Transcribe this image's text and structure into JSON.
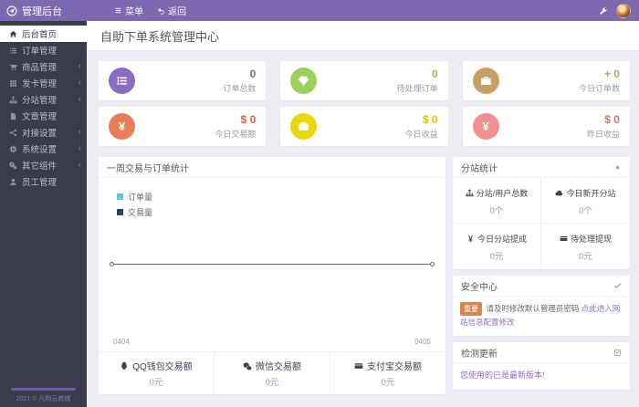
{
  "app": {
    "brand": "管理后台",
    "menu_label": "菜单",
    "back_label": "返回"
  },
  "sidebar": {
    "items": [
      {
        "id": "dashboard",
        "label": "后台首页",
        "icon": "home",
        "active": true,
        "has_children": false
      },
      {
        "id": "orders",
        "label": "订单管理",
        "icon": "list",
        "active": false,
        "has_children": false
      },
      {
        "id": "products",
        "label": "商品管理",
        "icon": "cart",
        "active": false,
        "has_children": true
      },
      {
        "id": "cards",
        "label": "发卡管理",
        "icon": "grid",
        "active": false,
        "has_children": true
      },
      {
        "id": "substations",
        "label": "分站管理",
        "icon": "sitemap",
        "active": false,
        "has_children": true
      },
      {
        "id": "articles",
        "label": "文章管理",
        "icon": "file",
        "active": false,
        "has_children": false
      },
      {
        "id": "integration",
        "label": "对接设置",
        "icon": "share",
        "active": false,
        "has_children": true
      },
      {
        "id": "system",
        "label": "系统设置",
        "icon": "gear",
        "active": false,
        "has_children": true
      },
      {
        "id": "components",
        "label": "其它组件",
        "icon": "cogs",
        "active": false,
        "has_children": true
      },
      {
        "id": "staff",
        "label": "员工管理",
        "icon": "users",
        "active": false,
        "has_children": false
      }
    ],
    "footer": "2021 © 凡购云商城"
  },
  "page": {
    "title": "自助下单系统管理中心"
  },
  "stats": [
    {
      "id": "order-total",
      "label": "订单总数",
      "value": "0",
      "icon": "ol",
      "color": "#8b6cc3",
      "value_color": "#7a5fc0"
    },
    {
      "id": "order-pending",
      "label": "待处理订单",
      "value": "0",
      "icon": "gem",
      "color": "#9bd05e",
      "value_color": "#8cc44f"
    },
    {
      "id": "order-today",
      "label": "今日订单数",
      "value": "+ 0",
      "icon": "briefcase",
      "color": "#c7a163",
      "value_color": "#c3a05f"
    },
    {
      "id": "trade-today",
      "label": "今日交易额",
      "value": "$ 0",
      "icon": "yen",
      "color": "#e57e55",
      "value_color": "#e05b43"
    },
    {
      "id": "income-today",
      "label": "今日收益",
      "value": "$ 0",
      "icon": "briefcase",
      "color": "#e8d70c",
      "value_color": "#d4c708"
    },
    {
      "id": "income-yesterday",
      "label": "昨日收益",
      "value": "$ 0",
      "icon": "yen",
      "color": "#f0918f",
      "value_color": "#e96a5e"
    }
  ],
  "chart_data": {
    "type": "line",
    "title": "一周交易与订单统计",
    "x": [
      "0404",
      "0405"
    ],
    "series": [
      {
        "name": "订单量",
        "color": "#67c8dc",
        "values": [
          0,
          0
        ]
      },
      {
        "name": "交易量",
        "color": "#2f4554",
        "values": [
          0,
          0
        ]
      }
    ],
    "ylim": [
      0,
      1
    ],
    "grid": false,
    "legend_position": "top-left"
  },
  "payments": [
    {
      "label": "QQ钱包交易额",
      "value": "0元",
      "icon": "qq"
    },
    {
      "label": "微信交易额",
      "value": "0元",
      "icon": "wechat"
    },
    {
      "label": "支付宝交易额",
      "value": "0元",
      "icon": "card"
    }
  ],
  "substation_panel": {
    "title": "分站统计",
    "cells": [
      {
        "label": "分站/用户总数",
        "value": "0个",
        "icon": "sitemap"
      },
      {
        "label": "今日新开分站",
        "value": "0个",
        "icon": "cloud"
      },
      {
        "label": "今日分站提成",
        "value": "0元",
        "icon": "yen"
      },
      {
        "label": "待处理提现",
        "value": "0元",
        "icon": "card"
      }
    ]
  },
  "security_panel": {
    "title": "安全中心",
    "badge": "重要",
    "message": "请及时修改默认管理员密码",
    "link": "点此进入网站信息配置修改"
  },
  "update_panel": {
    "title": "检测更新",
    "message": "您使用的已是最新版本!"
  },
  "colors": {
    "accent": "#7c69af",
    "sidebar": "#393d49",
    "link": "#8d6fc8",
    "badge": "#d8854f"
  }
}
